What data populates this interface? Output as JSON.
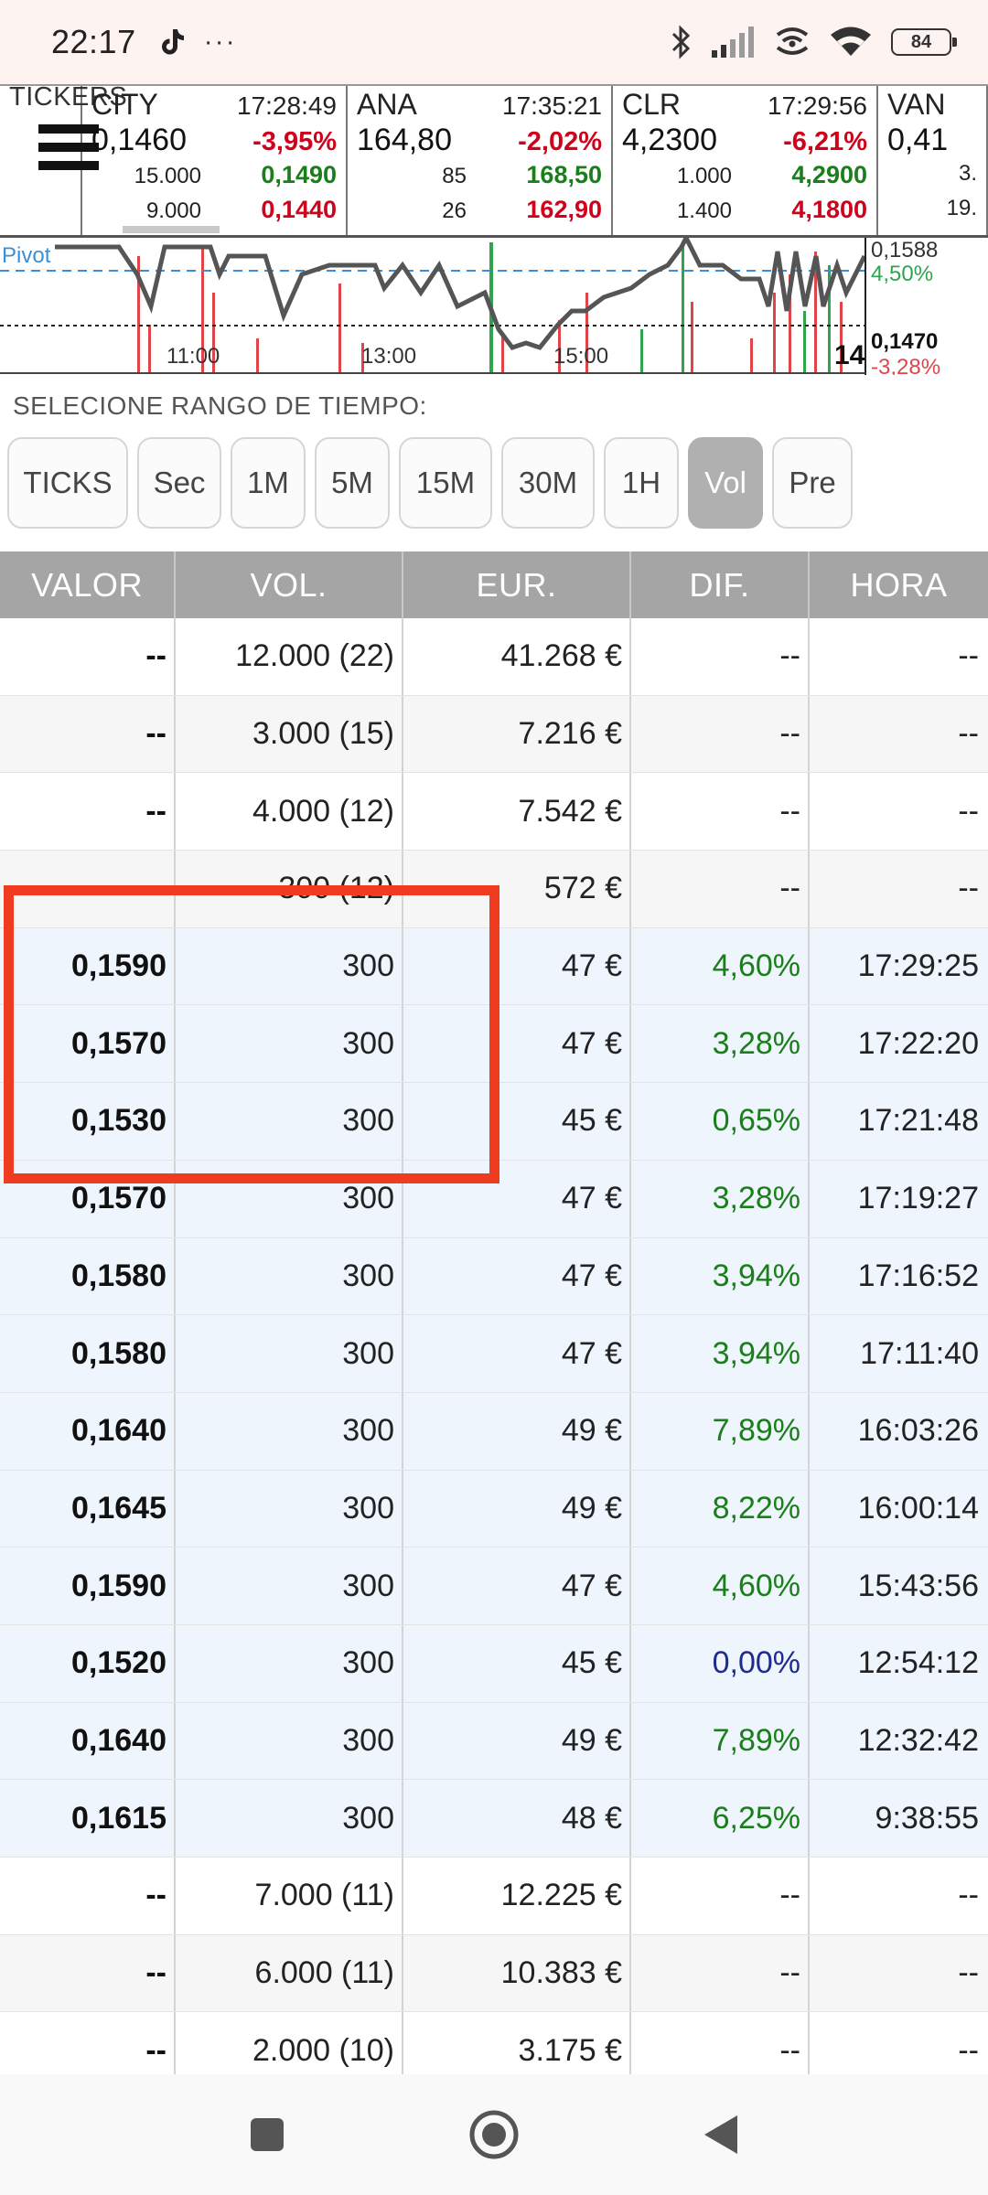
{
  "status_bar": {
    "time": "22:17",
    "notification_dots": "···",
    "battery": "84",
    "icons": [
      "tiktok-icon",
      "bluetooth-icon",
      "signal-icon",
      "hotspot-icon",
      "wifi-icon",
      "battery-icon"
    ]
  },
  "tickers_label": "TICKERS",
  "tickers": [
    {
      "symbol": "CITY",
      "time": "17:28:49",
      "price": "0,1460",
      "change": "-3,95%",
      "bid_vol": "15.000",
      "bid": "0,1490",
      "ask_vol": "9.000",
      "ask": "0,1440"
    },
    {
      "symbol": "ANA",
      "time": "17:35:21",
      "price": "164,80",
      "change": "-2,02%",
      "bid_vol": "85",
      "bid": "168,50",
      "ask_vol": "26",
      "ask": "162,90"
    },
    {
      "symbol": "CLR",
      "time": "17:29:56",
      "price": "4,2300",
      "change": "-6,21%",
      "bid_vol": "1.000",
      "bid": "4,2900",
      "ask_vol": "1.400",
      "ask": "4,1800"
    },
    {
      "symbol": "VAN",
      "price": "0,41",
      "bid_vol": "3.",
      "ask_vol": "19."
    }
  ],
  "mini_chart": {
    "pivot_label": "Pivot",
    "x_labels": [
      "11:00",
      "13:00",
      "15:00",
      "14"
    ],
    "right_labels": {
      "top": "0,1588",
      "pct": "4,50%",
      "bottom": "0,1470",
      "neg": "-3,28%"
    },
    "colors": {
      "price_line": "#555555",
      "pivot_line": "#3b8fd6",
      "up_bar": "#2ea44f",
      "down_bar": "#e0454a"
    }
  },
  "range": {
    "title": "SELECIONE RANGO DE TIEMPO:",
    "buttons": [
      "TICKS",
      "Sec",
      "1M",
      "5M",
      "15M",
      "30M",
      "1H",
      "Vol",
      "Pre"
    ],
    "selected": "Vol"
  },
  "table": {
    "headers": [
      "VALOR",
      "VOL.",
      "EUR.",
      "DIF.",
      "HORA"
    ],
    "rows": [
      {
        "valor": "--",
        "vol": "12.000 (22)",
        "eur": "41.268 €",
        "dif": "--",
        "hora": "--"
      },
      {
        "valor": "--",
        "vol": "3.000 (15)",
        "eur": "7.216 €",
        "dif": "--",
        "hora": "--"
      },
      {
        "valor": "--",
        "vol": "4.000 (12)",
        "eur": "7.542 €",
        "dif": "--",
        "hora": "--"
      },
      {
        "valor": "--",
        "vol": "300 (12)",
        "eur": "572 €",
        "dif": "--",
        "hora": "--"
      },
      {
        "valor": "0,1590",
        "vol": "300",
        "eur": "47 €",
        "dif": "4,60%",
        "hora": "17:29:25"
      },
      {
        "valor": "0,1570",
        "vol": "300",
        "eur": "47 €",
        "dif": "3,28%",
        "hora": "17:22:20"
      },
      {
        "valor": "0,1530",
        "vol": "300",
        "eur": "45 €",
        "dif": "0,65%",
        "hora": "17:21:48"
      },
      {
        "valor": "0,1570",
        "vol": "300",
        "eur": "47 €",
        "dif": "3,28%",
        "hora": "17:19:27"
      },
      {
        "valor": "0,1580",
        "vol": "300",
        "eur": "47 €",
        "dif": "3,94%",
        "hora": "17:16:52"
      },
      {
        "valor": "0,1580",
        "vol": "300",
        "eur": "47 €",
        "dif": "3,94%",
        "hora": "17:11:40"
      },
      {
        "valor": "0,1640",
        "vol": "300",
        "eur": "49 €",
        "dif": "7,89%",
        "hora": "16:03:26"
      },
      {
        "valor": "0,1645",
        "vol": "300",
        "eur": "49 €",
        "dif": "8,22%",
        "hora": "16:00:14"
      },
      {
        "valor": "0,1590",
        "vol": "300",
        "eur": "47 €",
        "dif": "4,60%",
        "hora": "15:43:56"
      },
      {
        "valor": "0,1520",
        "vol": "300",
        "eur": "45 €",
        "dif": "0,00%",
        "hora": "12:54:12"
      },
      {
        "valor": "0,1640",
        "vol": "300",
        "eur": "49 €",
        "dif": "7,89%",
        "hora": "12:32:42"
      },
      {
        "valor": "0,1615",
        "vol": "300",
        "eur": "48 €",
        "dif": "6,25%",
        "hora": "9:38:55"
      },
      {
        "valor": "--",
        "vol": "7.000 (11)",
        "eur": "12.225 €",
        "dif": "--",
        "hora": "--"
      },
      {
        "valor": "--",
        "vol": "6.000 (11)",
        "eur": "10.383 €",
        "dif": "--",
        "hora": "--"
      },
      {
        "valor": "--",
        "vol": "2.000 (10)",
        "eur": "3.175 €",
        "dif": "--",
        "hora": "--"
      }
    ],
    "colors": {
      "header_bg": "#a5a5a5",
      "trade_row_bg": "#eef5fc",
      "positive": "#1a7f1a",
      "zero": "#1f2b8f",
      "highlight": "#ef3b1f"
    }
  },
  "navbar": {
    "icons": [
      "recents-square-icon",
      "home-circle-icon",
      "back-triangle-icon"
    ]
  }
}
